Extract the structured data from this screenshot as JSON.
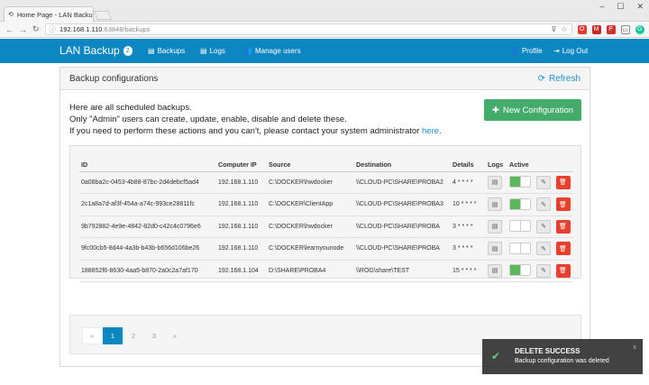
{
  "browser": {
    "tab_title": "Home Page - LAN Backu",
    "url_host": "192.168.1.110",
    "url_path": ":63848/backups"
  },
  "navbar": {
    "brand": "LAN Backup",
    "badge": "2",
    "backups": "Backups",
    "logs": "Logs",
    "users": "Manage users",
    "profile": "Profile",
    "logout": "Log Out"
  },
  "panel": {
    "title": "Backup configurations",
    "refresh": "Refresh",
    "intro1": "Here are all scheduled backups.",
    "intro2": "Only \"Admin\" users can create, update, enable, disable and delete these.",
    "intro3": "If you need to perform these actions and you can't, please contact your system administrator ",
    "intro_link": "here",
    "intro_end": ".",
    "new_button": "New Configuration"
  },
  "table": {
    "headers": [
      "ID",
      "Computer IP",
      "Source",
      "Destination",
      "Details",
      "Logs",
      "Active"
    ],
    "rows": [
      {
        "id": "0a08ba2c-0453-4b88-87bc-2d4debcf5ad4",
        "ip": "192.168.1.110",
        "source": "C:\\DOCKER\\hwdocker",
        "dest": "\\\\CLOUD-PC\\SHARE\\PROBA2",
        "details": "4 * * * *",
        "active": true
      },
      {
        "id": "2c1a8a7d-af3f-454a-a74c-993ce28811fc",
        "ip": "192.168.1.110",
        "source": "C:\\DOCKER\\ClientApp",
        "dest": "\\\\CLOUD-PC\\SHARE\\PROBA3",
        "details": "10 * * * *",
        "active": true
      },
      {
        "id": "9b792882-4e9e-4842-82d0-c42c4c0796e6",
        "ip": "192.168.1.110",
        "source": "C:\\DOCKER\\hwdocker",
        "dest": "\\\\CLOUD-PC\\SHARE\\PROBA",
        "details": "3 * * * *",
        "active": false
      },
      {
        "id": "9fc00cb5-8d44-4a3b-b43b-b656d106be26",
        "ip": "192.168.1.110",
        "source": "C:\\DOCKER\\learnyounode",
        "dest": "\\\\CLOUD-PC\\SHARE\\PROBA",
        "details": "3 * * * *",
        "active": false
      },
      {
        "id": "188852f6-8630-4aa5-b870-2a0c2a7af170",
        "ip": "192.168.1.104",
        "source": "D:\\SHARE\\PROBA4",
        "dest": "\\\\ROG\\share\\TEST",
        "details": "15 * * * *",
        "active": true
      }
    ]
  },
  "pagination": {
    "prev": "«",
    "pages": [
      "1",
      "2",
      "3"
    ],
    "next": "»",
    "current": "1"
  },
  "toast": {
    "title": "DELETE SUCCESS",
    "message": "Backup configuration was deleted",
    "close": "x"
  },
  "colors": {
    "navbar": "#0c87c2",
    "success": "#43ac6a",
    "danger": "#e7412e"
  }
}
